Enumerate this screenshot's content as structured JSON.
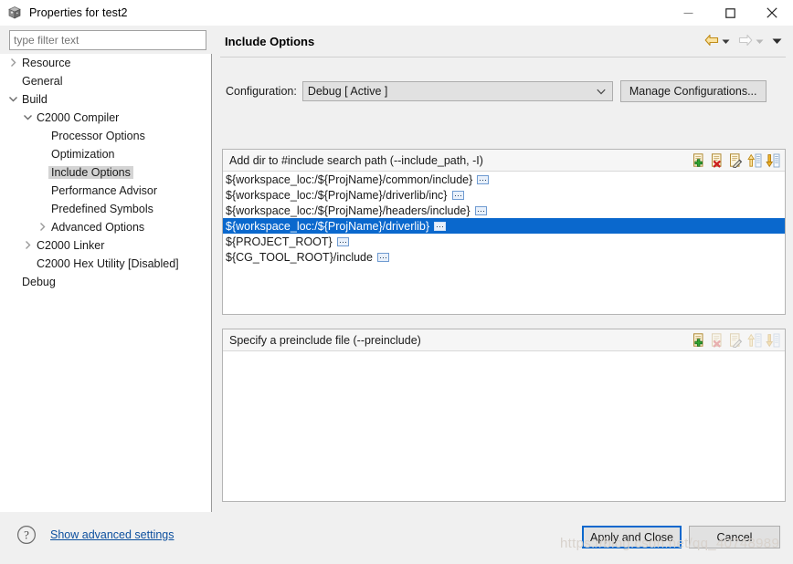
{
  "window": {
    "title": "Properties for test2",
    "icon": "cube-icon",
    "controls": {
      "minimize": "minimize-icon",
      "maximize": "maximize-icon",
      "close": "close-icon"
    }
  },
  "sidebar": {
    "filter": {
      "placeholder": "type filter text",
      "value": ""
    },
    "items": [
      {
        "label": "Resource",
        "indent": 0,
        "chevron": "collapsed",
        "selected": false
      },
      {
        "label": "General",
        "indent": 0,
        "chevron": "none",
        "selected": false
      },
      {
        "label": "Build",
        "indent": 0,
        "chevron": "expanded",
        "selected": false
      },
      {
        "label": "C2000 Compiler",
        "indent": 1,
        "chevron": "expanded",
        "selected": false
      },
      {
        "label": "Processor Options",
        "indent": 2,
        "chevron": "none",
        "selected": false
      },
      {
        "label": "Optimization",
        "indent": 2,
        "chevron": "none",
        "selected": false
      },
      {
        "label": "Include Options",
        "indent": 2,
        "chevron": "none",
        "selected": true
      },
      {
        "label": "Performance Advisor",
        "indent": 2,
        "chevron": "none",
        "selected": false
      },
      {
        "label": "Predefined Symbols",
        "indent": 2,
        "chevron": "none",
        "selected": false
      },
      {
        "label": "Advanced Options",
        "indent": 2,
        "chevron": "collapsed",
        "selected": false
      },
      {
        "label": "C2000 Linker",
        "indent": 1,
        "chevron": "collapsed",
        "selected": false
      },
      {
        "label": "C2000 Hex Utility  [Disabled]",
        "indent": 1,
        "chevron": "none",
        "selected": false
      },
      {
        "label": "Debug",
        "indent": 0,
        "chevron": "none",
        "selected": false
      }
    ]
  },
  "page": {
    "title": "Include Options",
    "nav": {
      "back_icon": "back-arrow-icon",
      "back_dropdown_icon": "chevron-down-icon",
      "forward_icon": "forward-arrow-icon",
      "forward_dropdown_icon": "chevron-down-icon",
      "menu_icon": "chevron-down-icon"
    },
    "configuration": {
      "label": "Configuration:",
      "selected": "Debug  [ Active ]",
      "options": [
        "Debug  [ Active ]"
      ],
      "manage_button": "Manage Configurations..."
    },
    "groups": [
      {
        "title": "Add dir to #include search path (--include_path, -I)",
        "tools": [
          {
            "name": "add-icon",
            "disabled": false
          },
          {
            "name": "delete-icon",
            "disabled": false
          },
          {
            "name": "edit-icon",
            "disabled": false
          },
          {
            "name": "move-up-icon",
            "disabled": false
          },
          {
            "name": "move-down-icon",
            "disabled": false
          }
        ],
        "rows": [
          {
            "text": "${workspace_loc:/${ProjName}/common/include}",
            "badge": true,
            "selected": false
          },
          {
            "text": "${workspace_loc:/${ProjName}/driverlib/inc}",
            "badge": true,
            "selected": false
          },
          {
            "text": "${workspace_loc:/${ProjName}/headers/include}",
            "badge": true,
            "selected": false
          },
          {
            "text": "${workspace_loc:/${ProjName}/driverlib}",
            "badge": true,
            "selected": true
          },
          {
            "text": "${PROJECT_ROOT}",
            "badge": true,
            "selected": false
          },
          {
            "text": "${CG_TOOL_ROOT}/include",
            "badge": true,
            "selected": false
          }
        ]
      },
      {
        "title": "Specify a preinclude file (--preinclude)",
        "tools": [
          {
            "name": "add-icon",
            "disabled": false
          },
          {
            "name": "delete-icon",
            "disabled": true
          },
          {
            "name": "edit-icon",
            "disabled": true
          },
          {
            "name": "move-up-icon",
            "disabled": true
          },
          {
            "name": "move-down-icon",
            "disabled": true
          }
        ],
        "rows": []
      }
    ]
  },
  "footer": {
    "help_icon": "help-icon",
    "advanced_link": "Show advanced settings",
    "apply_button": "Apply and Close",
    "cancel_button": "Cancel",
    "watermark": "https://blog.csdn.net/qq_40748989"
  },
  "colors": {
    "selection_blue": "#0a68cd",
    "link_blue": "#0c4f9e",
    "dialog_gray": "#f0f0f0",
    "nav_active_gold": "#e8a317"
  }
}
